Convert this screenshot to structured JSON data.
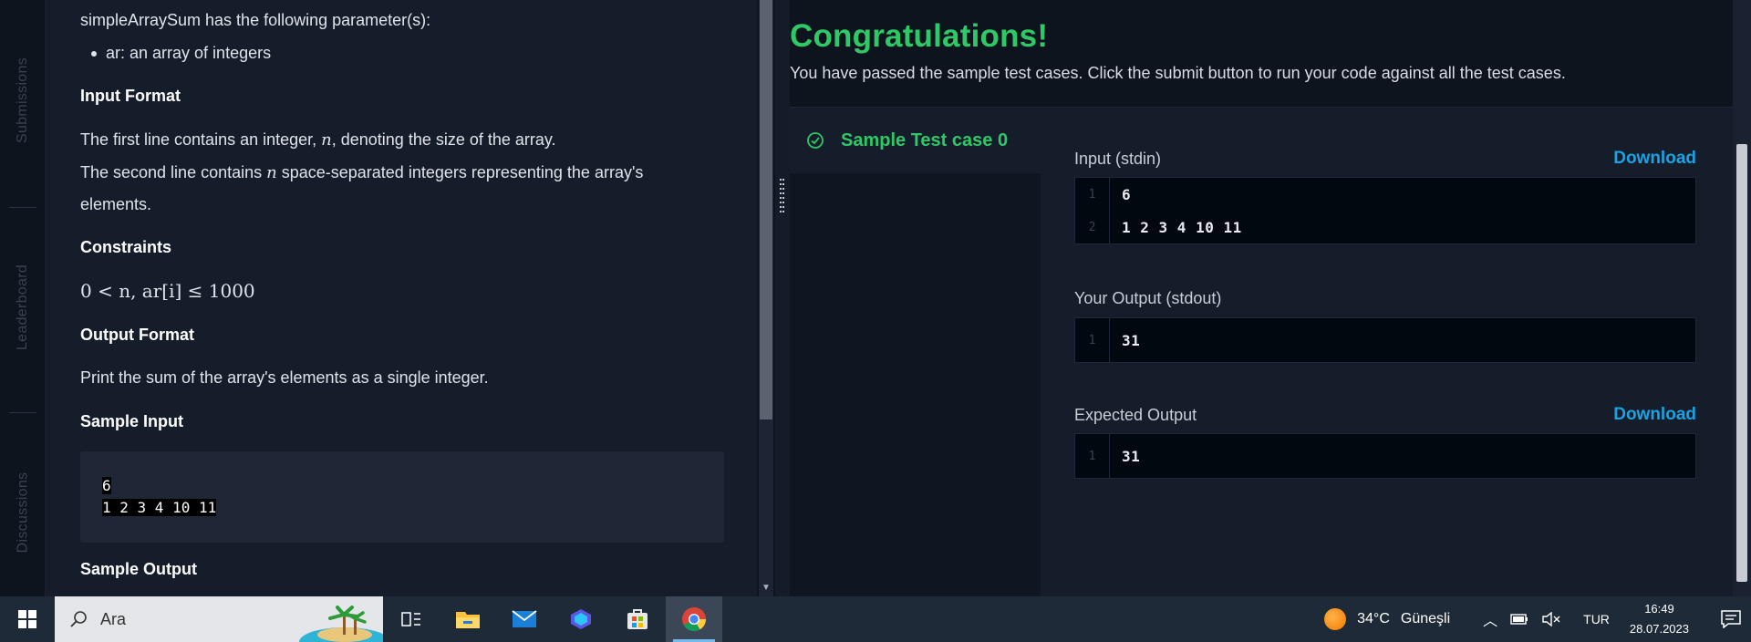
{
  "rail": {
    "tabs": [
      "Submissions",
      "Leaderboard",
      "Discussions"
    ]
  },
  "problem": {
    "param_intro": "simpleArraySum has the following parameter(s):",
    "param_bullet": "ar: an array of integers",
    "input_format_heading": "Input Format",
    "input_line1_pre": "The first line contains an integer, ",
    "input_line1_var": "n",
    "input_line1_post": ", denoting the size of the array.",
    "input_line2_pre": "The second line contains ",
    "input_line2_var": "n",
    "input_line2_post": " space-separated integers representing the array's",
    "input_line3": "elements.",
    "constraints_heading": "Constraints",
    "constraint_formula": "0 < n, ar[i] ≤ 1000",
    "output_format_heading": "Output Format",
    "output_format_text": "Print the sum of the array's elements as a single integer.",
    "sample_input_heading": "Sample Input",
    "sample_input_lines": [
      "6",
      "1 2 3 4 10 11"
    ],
    "sample_output_heading": "Sample Output"
  },
  "results": {
    "congrats": "Congratulations!",
    "passed_message": "You have passed the sample test cases. Click the submit button to run your code against all the test cases.",
    "test_case_label": "Sample Test case 0",
    "input_label": "Input (stdin)",
    "download_label": "Download",
    "input_lines": [
      {
        "n": "1",
        "v": "6"
      },
      {
        "n": "2",
        "v": "1 2 3 4 10 11"
      }
    ],
    "your_output_label": "Your Output (stdout)",
    "your_output_lines": [
      {
        "n": "1",
        "v": "31"
      }
    ],
    "expected_label": "Expected Output",
    "expected_lines": [
      {
        "n": "1",
        "v": "31"
      }
    ]
  },
  "taskbar": {
    "search_placeholder": "Ara",
    "weather_temp": "34°C",
    "weather_desc": "Güneşli",
    "language": "TUR",
    "time": "16:49",
    "date": "28.07.2023"
  },
  "colors": {
    "accent_green": "#2ec866",
    "link_blue": "#1ba2e4",
    "bg_dark": "#0e141e"
  }
}
